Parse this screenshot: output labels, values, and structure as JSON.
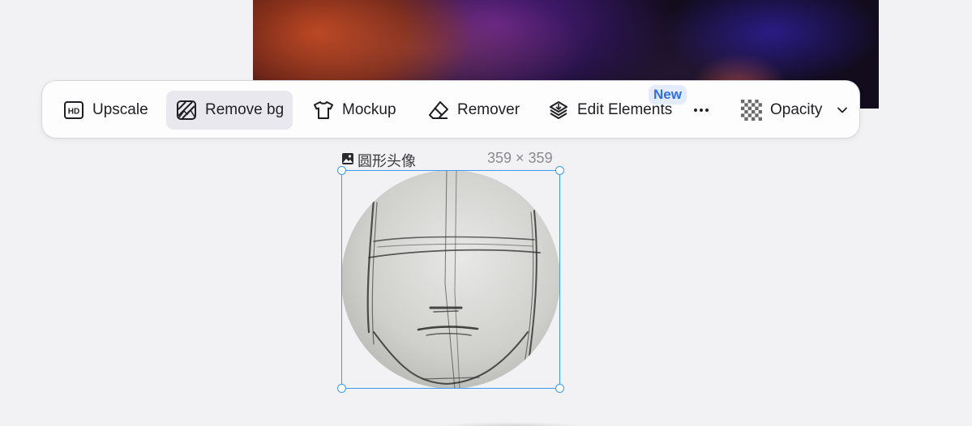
{
  "toolbar": {
    "items": [
      {
        "label": "Upscale",
        "icon": "hd-icon"
      },
      {
        "label": "Remove bg",
        "icon": "remove-bg-icon",
        "active": true
      },
      {
        "label": "Mockup",
        "icon": "tshirt-icon"
      },
      {
        "label": "Remover",
        "icon": "eraser-icon"
      },
      {
        "label": "Edit Elements",
        "icon": "layers-icon"
      },
      {
        "label": "Opacity",
        "icon": "checkerboard-icon"
      }
    ],
    "new_badge": "New"
  },
  "selection": {
    "name": "圆形头像",
    "size": "359 × 359"
  },
  "colors": {
    "accent": "#3d9af0",
    "badge_text": "#2f6fe0",
    "badge_bg": "#e4ecfb"
  }
}
